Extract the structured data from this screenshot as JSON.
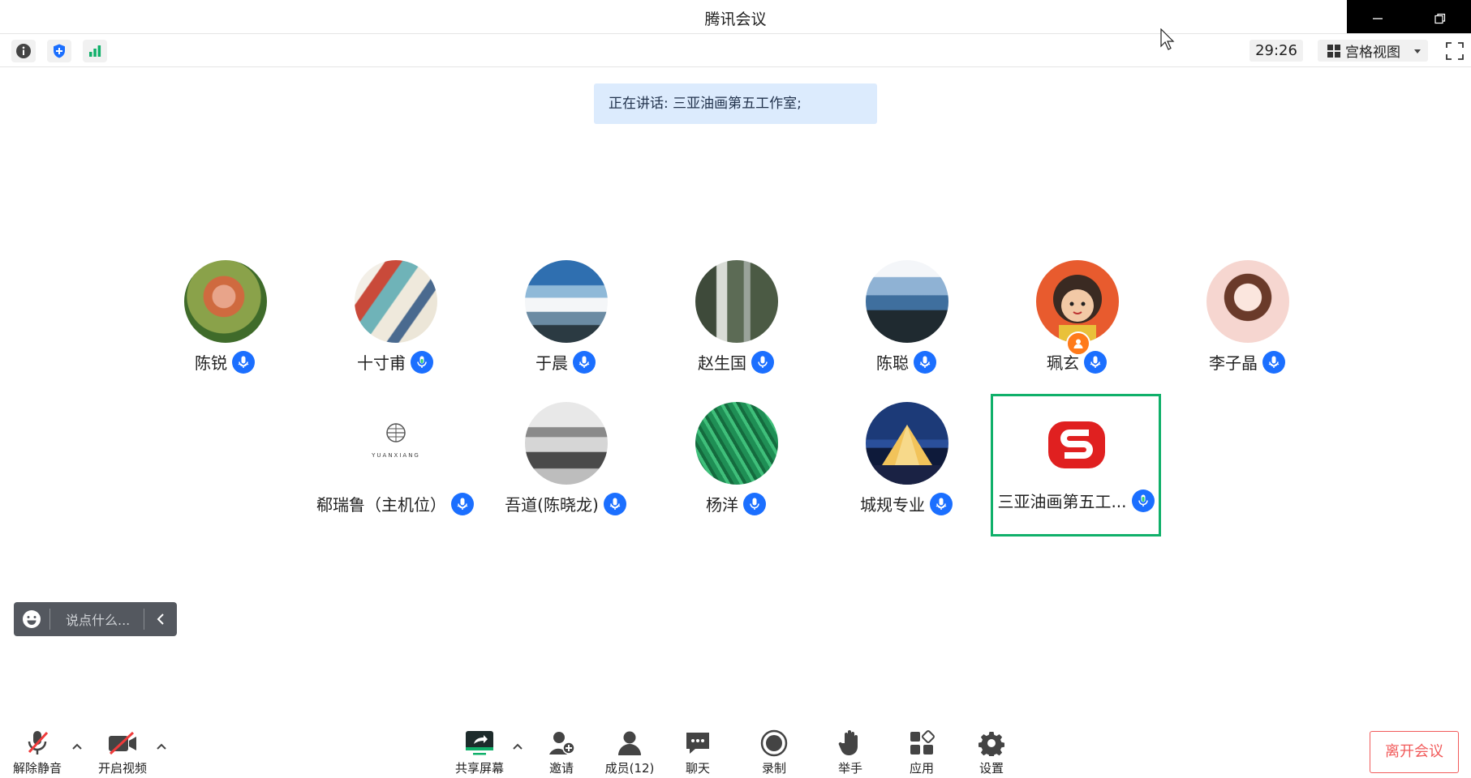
{
  "window": {
    "title": "腾讯会议"
  },
  "toolbar": {
    "timer": "29:26",
    "view_label": "宫格视图"
  },
  "speaking": {
    "text": "正在讲话: 三亚油画第五工作室;"
  },
  "participants": [
    {
      "name": "陈锐",
      "mic": "speaking"
    },
    {
      "name": "十寸甫",
      "mic": "green"
    },
    {
      "name": "于晨",
      "mic": "speaking"
    },
    {
      "name": "赵生国",
      "mic": "blue"
    },
    {
      "name": "陈聪",
      "mic": "speaking"
    },
    {
      "name": "珮玄",
      "mic": "speaking",
      "host": true
    },
    {
      "name": "李子晶",
      "mic": "speaking"
    },
    {
      "name": "郗瑞鲁（主机位）",
      "mic": "speaking",
      "logo_text": "YUANXIANG"
    },
    {
      "name": "吾道(陈晓龙)",
      "mic": "speaking"
    },
    {
      "name": "杨洋",
      "mic": "blue"
    },
    {
      "name": "城规专业",
      "mic": "speaking"
    },
    {
      "name": "三亚油画第五工...",
      "mic": "green",
      "active": true
    }
  ],
  "chat": {
    "placeholder": "说点什么..."
  },
  "bottom": {
    "unmute": "解除静音",
    "video": "开启视频",
    "share": "共享屏幕",
    "invite": "邀请",
    "members": "成员(12)",
    "chat": "聊天",
    "record": "录制",
    "raise_hand": "举手",
    "apps": "应用",
    "settings": "设置",
    "leave": "离开会议"
  },
  "colors": {
    "accent": "#1b6fff",
    "active_border": "#10b06a",
    "leave": "#f15a5a"
  }
}
